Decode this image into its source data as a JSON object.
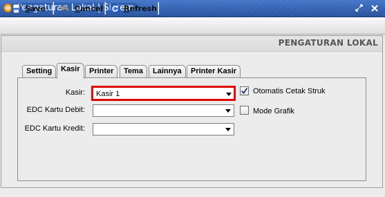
{
  "window": {
    "title": "Pengaturan Lokal | Sistem",
    "icon": "app-icon",
    "controls": [
      "restore-icon",
      "close-icon"
    ]
  },
  "toolbar": {
    "save_label": "Save",
    "cancel_label": "Cancel",
    "refresh_label": "Refresh"
  },
  "panel": {
    "title": "PENGATURAN LOKAL"
  },
  "tabs": [
    {
      "label": "Setting",
      "active": false
    },
    {
      "label": "Kasir",
      "active": true
    },
    {
      "label": "Printer",
      "active": false
    },
    {
      "label": "Tema",
      "active": false
    },
    {
      "label": "Lainnya",
      "active": false
    },
    {
      "label": "Printer Kasir",
      "active": false
    }
  ],
  "form": {
    "kasir": {
      "label": "Kasir:",
      "value": "Kasir 1",
      "highlight_color": "#e00000"
    },
    "edc_debit": {
      "label": "EDC Kartu Debit:",
      "value": ""
    },
    "edc_kredit": {
      "label": "EDC Kartu Kredit:",
      "value": ""
    },
    "auto_print": {
      "label": "Otomatis Cetak Struk",
      "checked": true
    },
    "graphic_mode": {
      "label": "Mode Grafik",
      "checked": false
    }
  },
  "colors": {
    "titlebar": "#2b5aa8",
    "highlight": "#e00000",
    "panel_title": "#555555"
  }
}
